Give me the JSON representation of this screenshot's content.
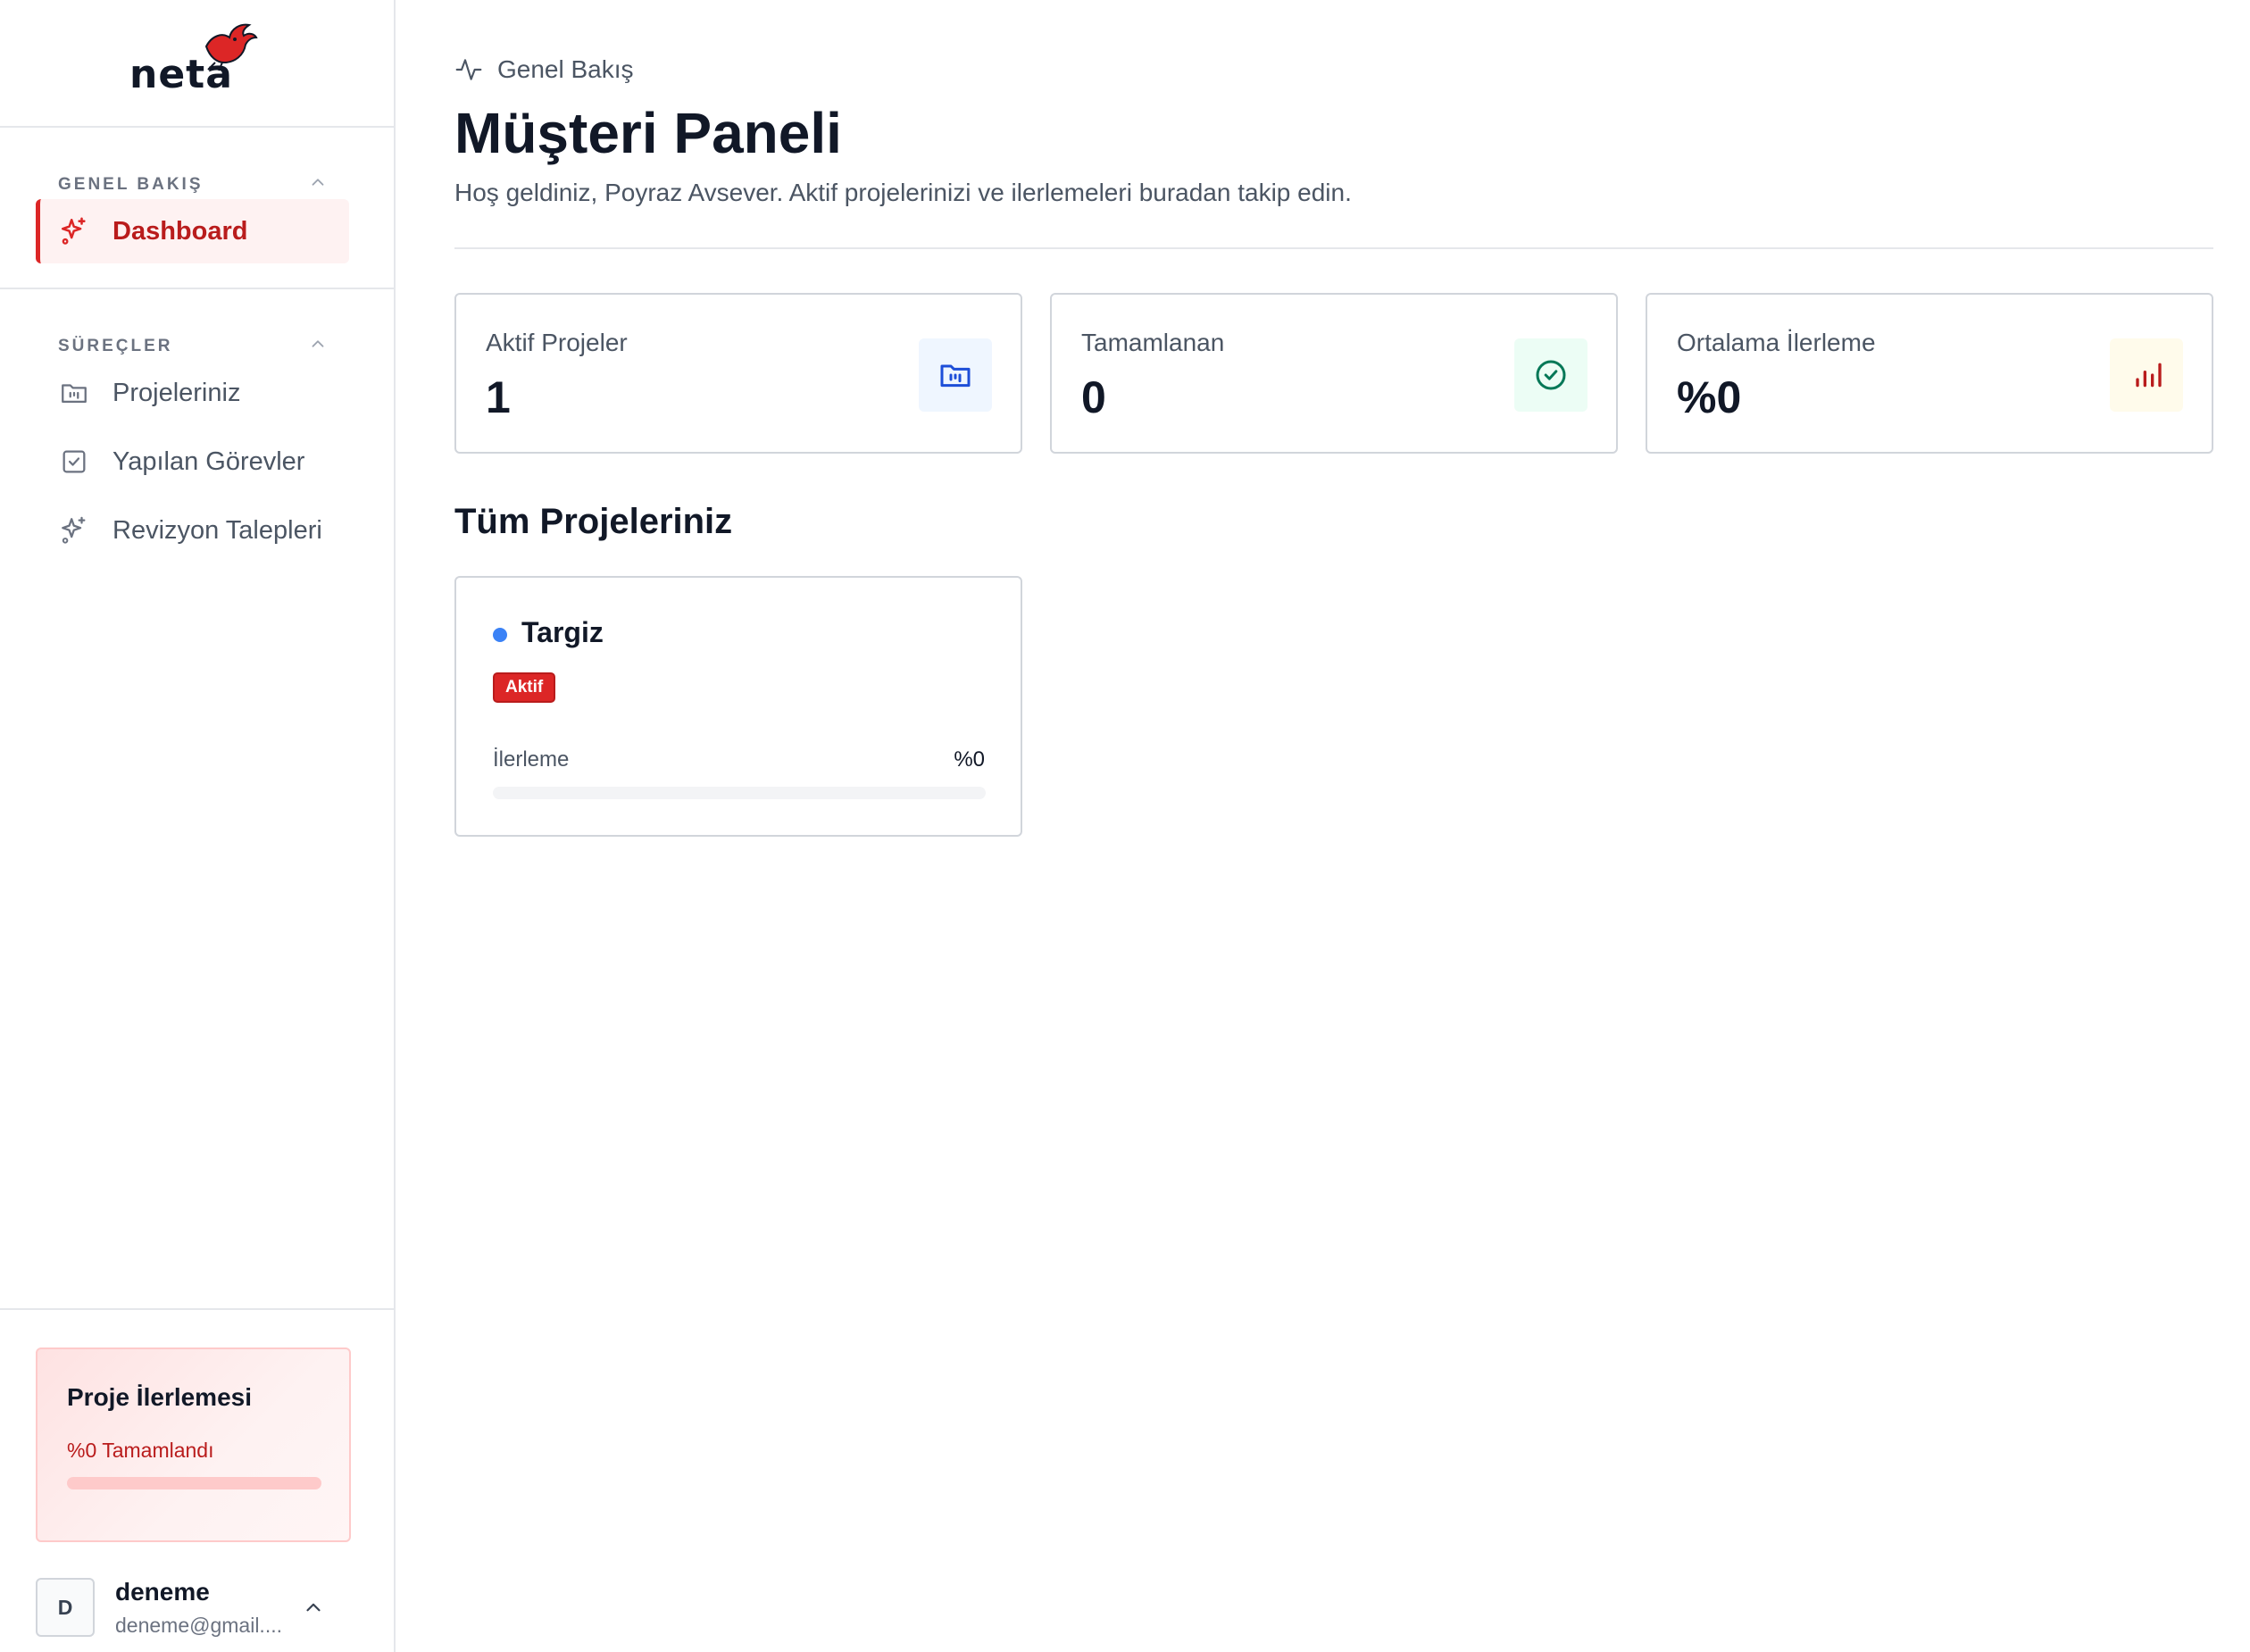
{
  "brand": {
    "name": "neta",
    "accent": "#dc2626"
  },
  "sidebar": {
    "sections": [
      {
        "title": "GENEL BAKIŞ",
        "items": [
          {
            "label": "Dashboard",
            "icon": "sparkles-icon",
            "active": true
          }
        ]
      },
      {
        "title": "SÜREÇLER",
        "items": [
          {
            "label": "Projeleriniz",
            "icon": "folder-icon",
            "active": false
          },
          {
            "label": "Yapılan Görevler",
            "icon": "checkbox-icon",
            "active": false
          },
          {
            "label": "Revizyon Talepleri",
            "icon": "sparkles-icon",
            "active": false
          }
        ]
      }
    ],
    "progress_card": {
      "title": "Proje İlerlemesi",
      "status": "%0 Tamamlandı",
      "percent": 0
    },
    "user": {
      "initial": "D",
      "name": "deneme",
      "email": "deneme@gmail...."
    }
  },
  "header": {
    "breadcrumb": "Genel Bakış",
    "title": "Müşteri Paneli",
    "subtitle": "Hoş geldiniz, Poyraz Avsever. Aktif projelerinizi ve ilerlemeleri buradan takip edin."
  },
  "stats": [
    {
      "label": "Aktif Projeler",
      "value": "1",
      "icon": "folder-kanban-icon",
      "icon_color": "#1d4ed8",
      "icon_bg": "#eff6ff"
    },
    {
      "label": "Tamamlanan",
      "value": "0",
      "icon": "check-circle-icon",
      "icon_color": "#047857",
      "icon_bg": "#ecfdf5"
    },
    {
      "label": "Ortalama İlerleme",
      "value": "%0",
      "icon": "bar-chart-icon",
      "icon_color": "#b91c1c",
      "icon_bg": "#fffbeb"
    }
  ],
  "projects_section": {
    "title": "Tüm Projeleriniz",
    "projects": [
      {
        "name": "Targiz",
        "status": "Aktif",
        "progress_label": "İlerleme",
        "progress_value": "%0",
        "percent": 0,
        "dot_color": "#3b82f6"
      }
    ]
  }
}
